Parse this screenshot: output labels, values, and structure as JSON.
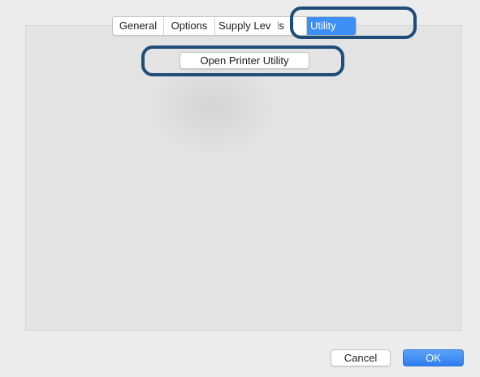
{
  "tabs": [
    {
      "label": "General",
      "active": false
    },
    {
      "label": "Options",
      "active": false
    },
    {
      "label": "Supply Levels",
      "active": false
    },
    {
      "label": "Utility",
      "active": true
    }
  ],
  "utility": {
    "open_button_label": "Open Printer Utility"
  },
  "footer": {
    "cancel_label": "Cancel",
    "ok_label": "OK"
  },
  "colors": {
    "accent": "#3d8ff5",
    "highlight_outline": "#1d4d78",
    "window_background": "#ececec"
  }
}
